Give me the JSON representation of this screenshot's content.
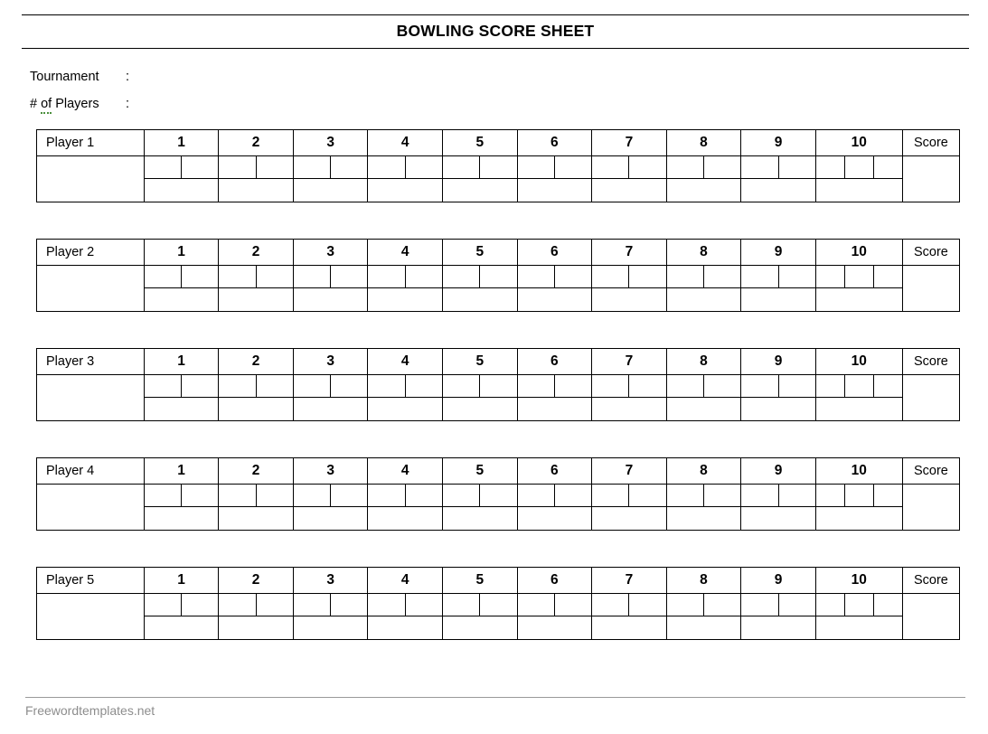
{
  "document": {
    "title": "BOWLING SCORE SHEET"
  },
  "meta": {
    "fields": [
      {
        "label": "Tournament",
        "label_prefix": "",
        "label_misspelled": "",
        "label_suffix": "",
        "colon": ":",
        "value": ""
      },
      {
        "label": "# of Players",
        "label_prefix": "# ",
        "label_misspelled": "of",
        "label_suffix": " Players",
        "colon": ":",
        "value": ""
      }
    ]
  },
  "table": {
    "frame_headers": [
      "1",
      "2",
      "3",
      "4",
      "5",
      "6",
      "7",
      "8",
      "9",
      "10"
    ],
    "score_header": "Score",
    "frames_with_two_balls": 9,
    "tenth_frame_balls": 3,
    "colors": {
      "fill_green": "#e8efdc",
      "fill_white": "#ffffff",
      "border": "#000000",
      "footer_text": "#8d8d8d",
      "spellcheck_underline": "#4a8f3c"
    }
  },
  "players": [
    {
      "name": "Player 1",
      "total": "",
      "balls": [
        "",
        "",
        "",
        "",
        "",
        "",
        "",
        "",
        "",
        "",
        "",
        "",
        "",
        "",
        "",
        "",
        "",
        "",
        "",
        "",
        ""
      ],
      "frame_totals": [
        "",
        "",
        "",
        "",
        "",
        "",
        "",
        "",
        "",
        ""
      ]
    },
    {
      "name": "Player 2",
      "total": "",
      "balls": [
        "",
        "",
        "",
        "",
        "",
        "",
        "",
        "",
        "",
        "",
        "",
        "",
        "",
        "",
        "",
        "",
        "",
        "",
        "",
        "",
        ""
      ],
      "frame_totals": [
        "",
        "",
        "",
        "",
        "",
        "",
        "",
        "",
        "",
        ""
      ]
    },
    {
      "name": "Player 3",
      "total": "",
      "balls": [
        "",
        "",
        "",
        "",
        "",
        "",
        "",
        "",
        "",
        "",
        "",
        "",
        "",
        "",
        "",
        "",
        "",
        "",
        "",
        "",
        ""
      ],
      "frame_totals": [
        "",
        "",
        "",
        "",
        "",
        "",
        "",
        "",
        "",
        ""
      ]
    },
    {
      "name": "Player 4",
      "total": "",
      "balls": [
        "",
        "",
        "",
        "",
        "",
        "",
        "",
        "",
        "",
        "",
        "",
        "",
        "",
        "",
        "",
        "",
        "",
        "",
        "",
        "",
        ""
      ],
      "frame_totals": [
        "",
        "",
        "",
        "",
        "",
        "",
        "",
        "",
        "",
        ""
      ]
    },
    {
      "name": "Player 5",
      "total": "",
      "balls": [
        "",
        "",
        "",
        "",
        "",
        "",
        "",
        "",
        "",
        "",
        "",
        "",
        "",
        "",
        "",
        "",
        "",
        "",
        "",
        "",
        ""
      ],
      "frame_totals": [
        "",
        "",
        "",
        "",
        "",
        "",
        "",
        "",
        "",
        ""
      ]
    }
  ],
  "footer": {
    "watermark": "Freewordtemplates.net"
  }
}
